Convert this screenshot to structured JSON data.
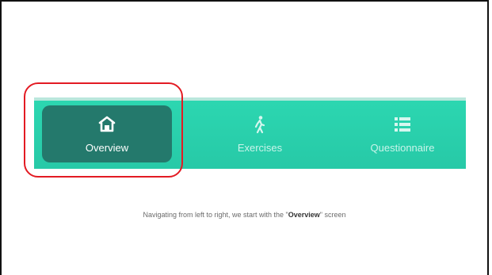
{
  "tabbar": {
    "background": "#2cd7b1",
    "active_background": "#24796c",
    "tabs": [
      {
        "label": "Overview",
        "icon": "home-icon",
        "active": true
      },
      {
        "label": "Exercises",
        "icon": "walking-person-icon",
        "active": false
      },
      {
        "label": "Questionnaire",
        "icon": "list-icon",
        "active": false
      }
    ]
  },
  "highlight_color": "#e31b23",
  "caption": {
    "prefix": "Navigating from left to right, we start with the \"",
    "emphasis": "Overview",
    "suffix": "\" screen"
  }
}
